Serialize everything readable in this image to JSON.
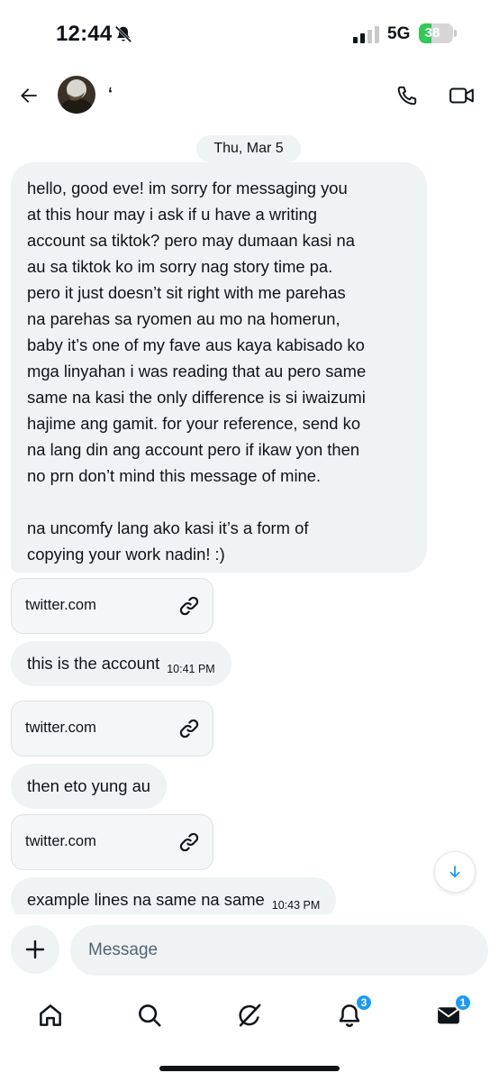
{
  "status_bar": {
    "time": "12:44",
    "network": "5G",
    "battery": "38",
    "battery_level": 0.38,
    "battery_color": "#34c759"
  },
  "header": {
    "contact_name": "‘",
    "icons": [
      "back-arrow-icon",
      "avatar",
      "phone-icon",
      "video-camera-icon"
    ]
  },
  "chat": {
    "date_separator": "Thu, Mar 5",
    "messages": [
      {
        "type": "text",
        "lines": [
          "hello, good eve! im sorry for messaging you",
          "at this hour may i ask if u have a writing",
          "account sa tiktok? pero may dumaan kasi na",
          "au sa tiktok ko im sorry nag story time pa.",
          "pero it just doesn’t sit right with me parehas",
          "na parehas sa ryomen au mo na homerun,",
          "baby it’s one of my fave aus kaya kabisado ko",
          "mga linyahan i was reading that au pero same",
          "same na kasi the only difference is si iwaizumi",
          "hajime ang gamit. for your reference, send ko",
          "na lang din ang account pero if ikaw yon then",
          "no prn don’t mind this message of mine.",
          "",
          "na uncomfy lang ako kasi it’s a form of",
          "copying your work nadin! :)"
        ]
      },
      {
        "type": "link",
        "domain": "twitter.com"
      },
      {
        "type": "text",
        "text": "this is the account",
        "time": "10:41 PM"
      },
      {
        "type": "link",
        "domain": "twitter.com"
      },
      {
        "type": "text",
        "text": "then eto yung au"
      },
      {
        "type": "link",
        "domain": "twitter.com"
      },
      {
        "type": "text",
        "text": "example lines na same na same",
        "time": "10:43 PM"
      }
    ]
  },
  "composer": {
    "placeholder": "Message"
  },
  "tabbar": {
    "notifications_badge": "3",
    "messages_badge": "1",
    "accent_color": "#1d9bf0"
  }
}
